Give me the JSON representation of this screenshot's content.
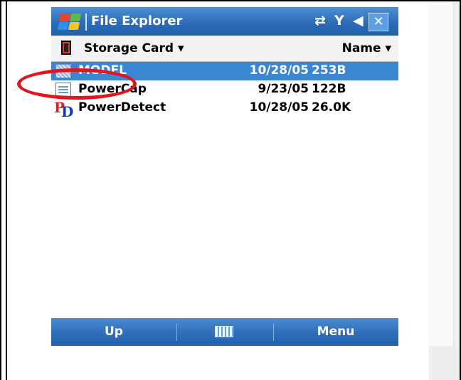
{
  "titlebar": {
    "title": "File Explorer",
    "status_icons": [
      "connectivity-icon",
      "signal-off-icon",
      "volume-icon"
    ],
    "close_label": "✕"
  },
  "folderbar": {
    "location": "Storage Card ▾",
    "sort": "Name ▾"
  },
  "files": [
    {
      "name": "MODEL",
      "date": "10/28/05",
      "size": "253B",
      "selected": true
    },
    {
      "name": "PowerCap",
      "date": "9/23/05",
      "size": "122B",
      "selected": false
    },
    {
      "name": "PowerDetect",
      "date": "10/28/05",
      "size": "26.0K",
      "selected": false
    }
  ],
  "menubar": {
    "left": "Up",
    "right": "Menu"
  },
  "colors": {
    "titlebar": "#2c6cb8",
    "selection": "#3a86d0",
    "annotation": "#e3141c"
  }
}
